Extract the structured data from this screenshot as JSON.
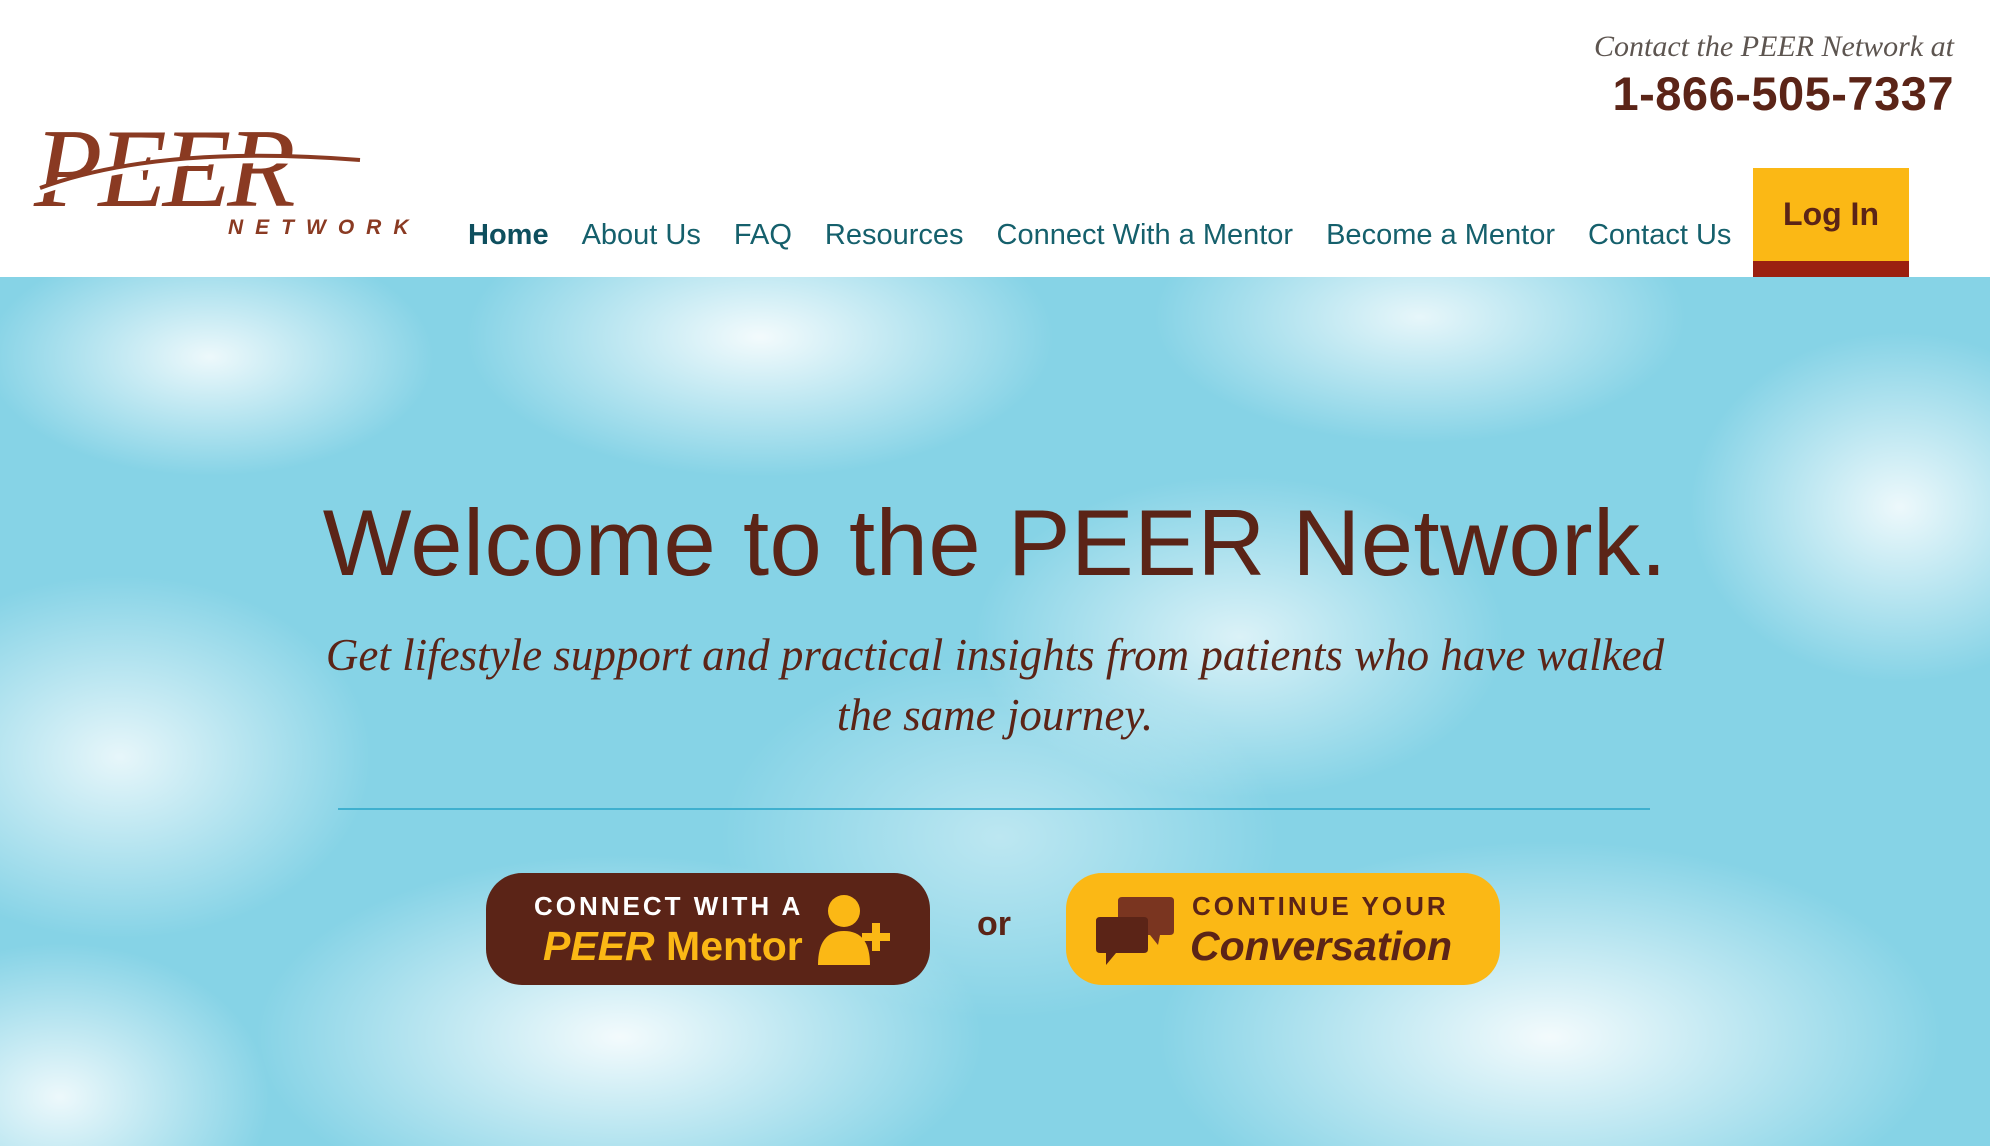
{
  "header": {
    "logo": {
      "main": "PEER",
      "sub": "NETWORK",
      "alt": "PEER Network logo"
    },
    "contact": {
      "line": "Contact the PEER Network at",
      "phone": "1-866-505-7337"
    },
    "nav": [
      {
        "label": "Home",
        "active": true
      },
      {
        "label": "About Us"
      },
      {
        "label": "FAQ"
      },
      {
        "label": "Resources"
      },
      {
        "label": "Connect With a Mentor"
      },
      {
        "label": "Become a Mentor"
      },
      {
        "label": "Contact Us"
      }
    ],
    "login_label": "Log In"
  },
  "hero": {
    "title": "Welcome to the PEER Network.",
    "subtitle": "Get lifestyle support and practical insights from patients who have walked the same journey.",
    "connect_button": {
      "line1": "CONNECT WITH A",
      "line2_em": "PEER",
      "line2_rest": " Mentor",
      "icon": "person-add-icon"
    },
    "or_text": "or",
    "continue_button": {
      "line1": "CONTINUE YOUR",
      "line2": "Conversation",
      "icon": "chat-bubbles-icon"
    }
  },
  "colors": {
    "brand_brown": "#5b2417",
    "accent_yellow": "#fbb815",
    "nav_teal": "#15606c",
    "login_bar": "#9b2010",
    "sky": "#86d3e6"
  }
}
